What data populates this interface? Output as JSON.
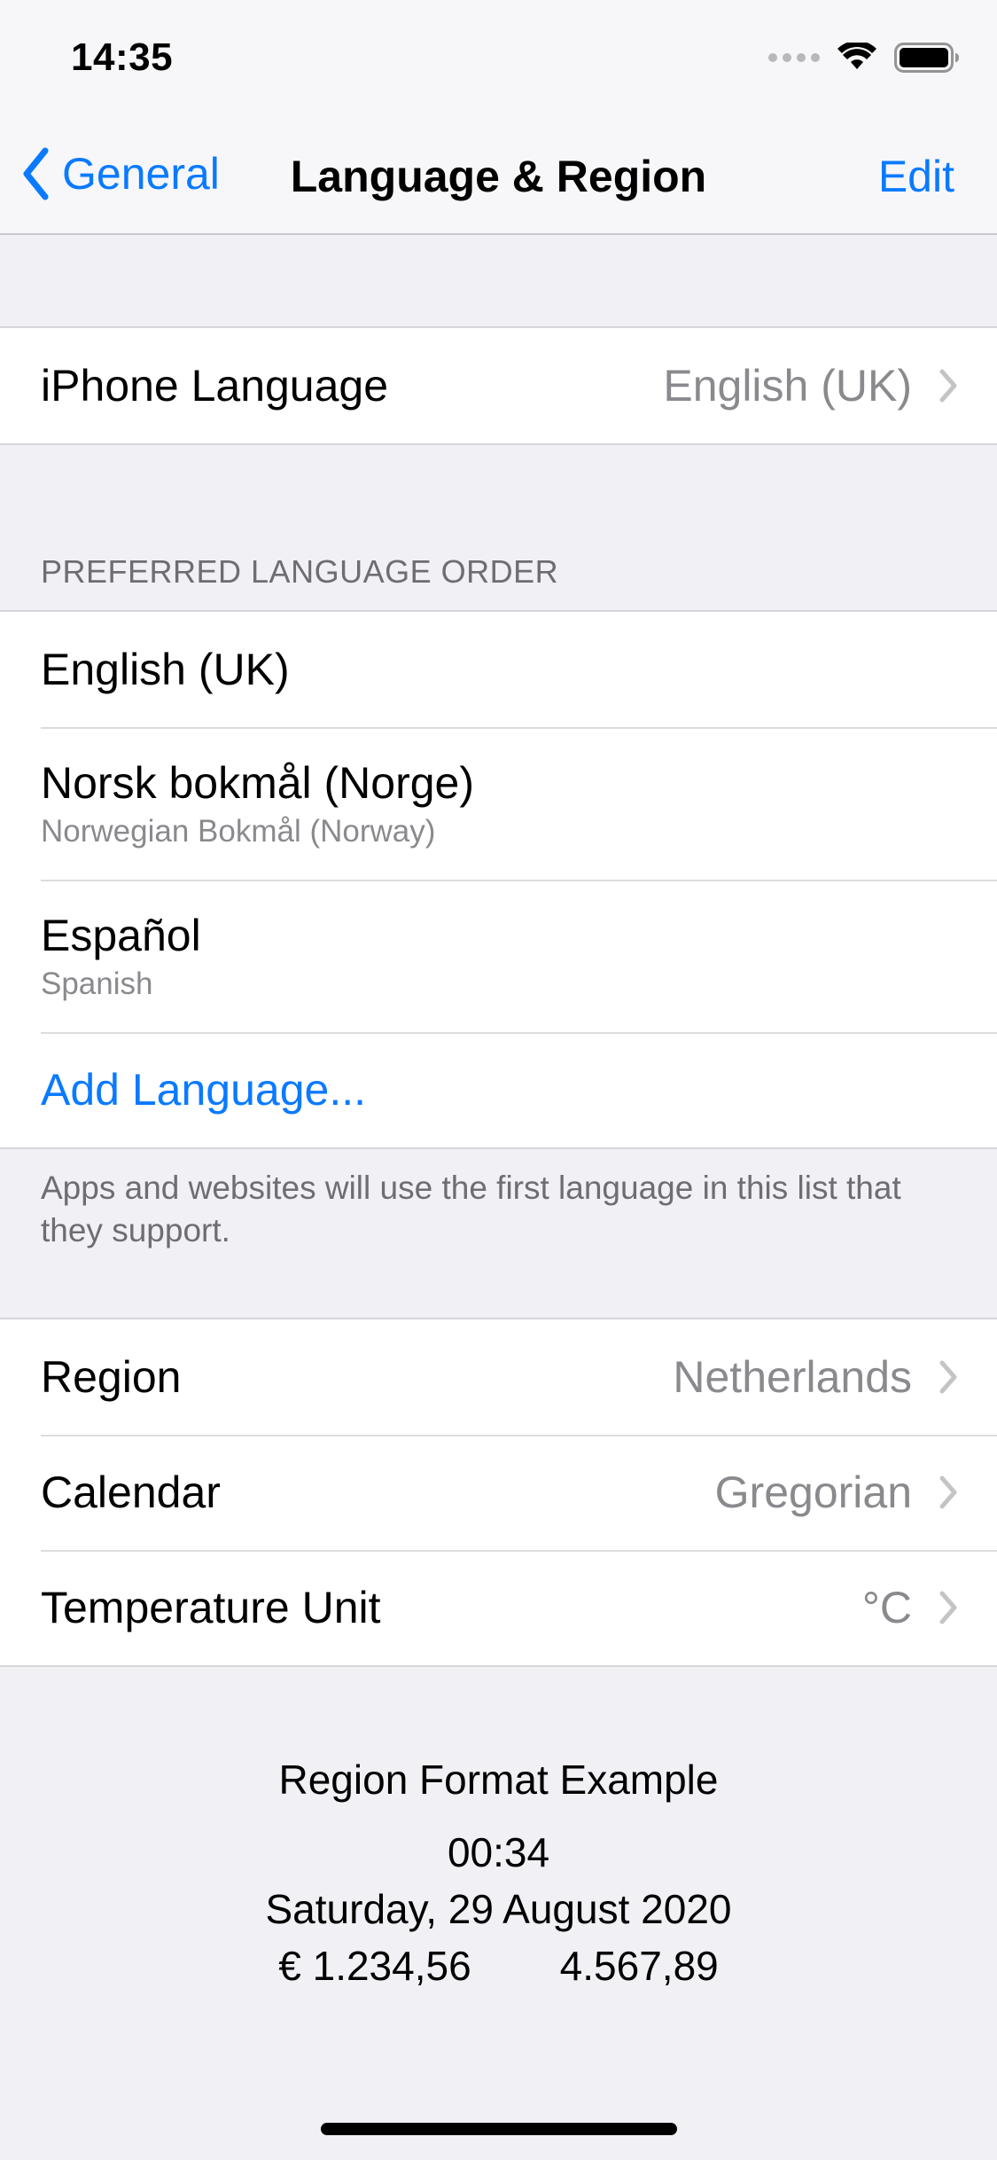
{
  "status_bar": {
    "time": "14:35",
    "icons": [
      "signal-dots-icon",
      "wifi-icon",
      "battery-icon"
    ]
  },
  "nav": {
    "back_label": "General",
    "title": "Language & Region",
    "edit_label": "Edit"
  },
  "iphone_language": {
    "label": "iPhone Language",
    "value": "English (UK)"
  },
  "preferred_languages": {
    "header": "PREFERRED LANGUAGE ORDER",
    "items": [
      {
        "label": "English (UK)",
        "subtitle": ""
      },
      {
        "label": "Norsk bokmål (Norge)",
        "subtitle": "Norwegian Bokmål (Norway)"
      },
      {
        "label": "Español",
        "subtitle": "Spanish"
      }
    ],
    "add_label": "Add Language...",
    "footer": "Apps and websites will use the first language in this list that they support."
  },
  "region_settings": [
    {
      "label": "Region",
      "value": "Netherlands"
    },
    {
      "label": "Calendar",
      "value": "Gregorian"
    },
    {
      "label": "Temperature Unit",
      "value": "°C"
    }
  ],
  "region_format_example": {
    "title": "Region Format Example",
    "time": "00:34",
    "date": "Saturday, 29 August 2020",
    "currency": "€ 1.234,56",
    "number": "4.567,89"
  },
  "colors": {
    "accent": "#0a7aff",
    "background": "#f0f0f5",
    "secondary_text": "#8a8a8e"
  }
}
